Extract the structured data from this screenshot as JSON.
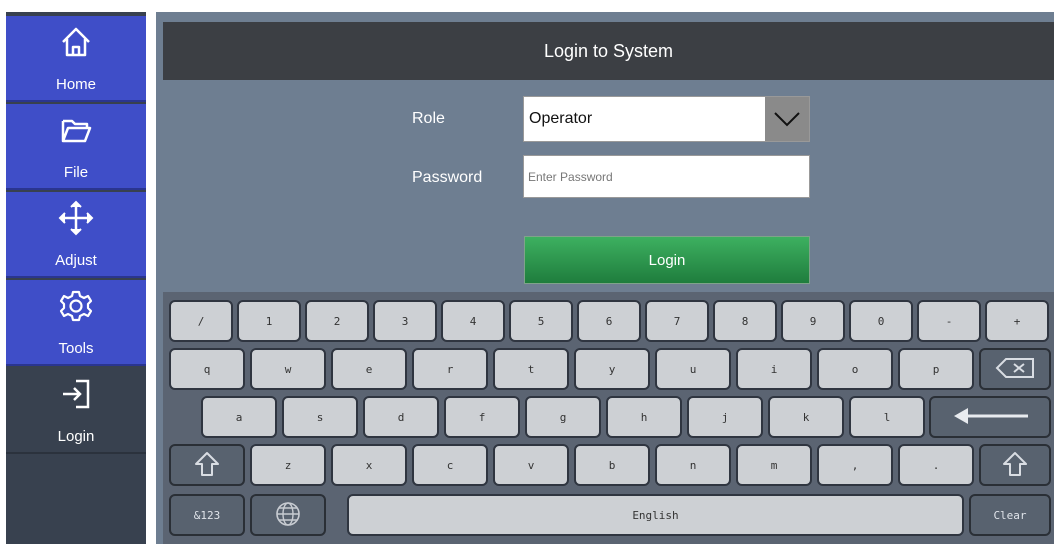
{
  "sidebar": {
    "items": [
      {
        "label": "Home",
        "icon": "home-icon"
      },
      {
        "label": "File",
        "icon": "folder-icon"
      },
      {
        "label": "Adjust",
        "icon": "move-arrows-icon"
      },
      {
        "label": "Tools",
        "icon": "gear-icon"
      },
      {
        "label": "Login",
        "icon": "login-icon"
      }
    ]
  },
  "dialog": {
    "title": "Login to System",
    "role_label": "Role",
    "role_value": "Operator",
    "password_label": "Password",
    "password_placeholder": "Enter Password",
    "password_value": "",
    "login_label": "Login"
  },
  "keyboard": {
    "rows": [
      [
        "/",
        "1",
        "2",
        "3",
        "4",
        "5",
        "6",
        "7",
        "8",
        "9",
        "0",
        "-",
        "+"
      ],
      [
        "q",
        "w",
        "e",
        "r",
        "t",
        "y",
        "u",
        "i",
        "o",
        "p"
      ],
      [
        "a",
        "s",
        "d",
        "f",
        "g",
        "h",
        "j",
        "k",
        "l"
      ],
      [
        "z",
        "x",
        "c",
        "v",
        "b",
        "n",
        "m",
        ",",
        "."
      ]
    ],
    "numeric_label": "&123",
    "space_label": "English",
    "clear_label": "Clear"
  },
  "colors": {
    "sidebar_active": "#3f4ec8",
    "sidebar_dark": "#38414f",
    "panel_bg": "#6e7e91",
    "header_bg": "#3c3f44",
    "login_green": "#2e9c4f",
    "key_light": "#cdd0d4",
    "key_dark": "#58626f"
  }
}
